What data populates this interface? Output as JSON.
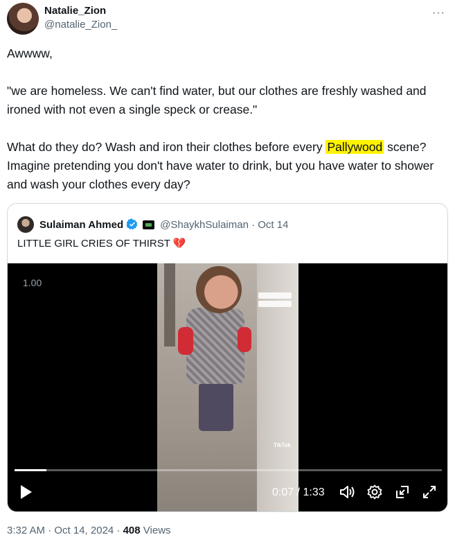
{
  "author": {
    "display_name": "Natalie_Zion",
    "handle": "@natalie_Zion_",
    "avatar_icon": "avatar-photo"
  },
  "more_label": "···",
  "tweet": {
    "line1": "Awwww,",
    "line2": "\"we are homeless. We can't find water, but our clothes are freshly washed and ironed with not even a single speck or crease.\"",
    "line3_before": "What do they do? Wash and iron their clothes before every ",
    "line3_highlight": "Pallywood",
    "line3_after": " scene? Imagine pretending you don't have water to drink, but you have water to shower and wash your clothes every day?"
  },
  "quote": {
    "display_name": "Sulaiman Ahmed",
    "handle_date": "@ShaykhSulaiman · Oct 14",
    "text": "LITTLE GIRL CRIES OF THIRST",
    "emoji": "💔",
    "video": {
      "speed": "1.00",
      "elapsed": "0:07",
      "duration": "1:33",
      "time_label": "0:07 / 1:33",
      "progress": 0.075,
      "watermark": "TikTok"
    }
  },
  "meta": {
    "time_date": "3:32 AM · Oct 14, 2024 · ",
    "views_count": "408",
    "views_label": " Views"
  },
  "colors": {
    "highlight": "#fff200",
    "verified": "#1d9bf0",
    "muted": "#536471"
  }
}
